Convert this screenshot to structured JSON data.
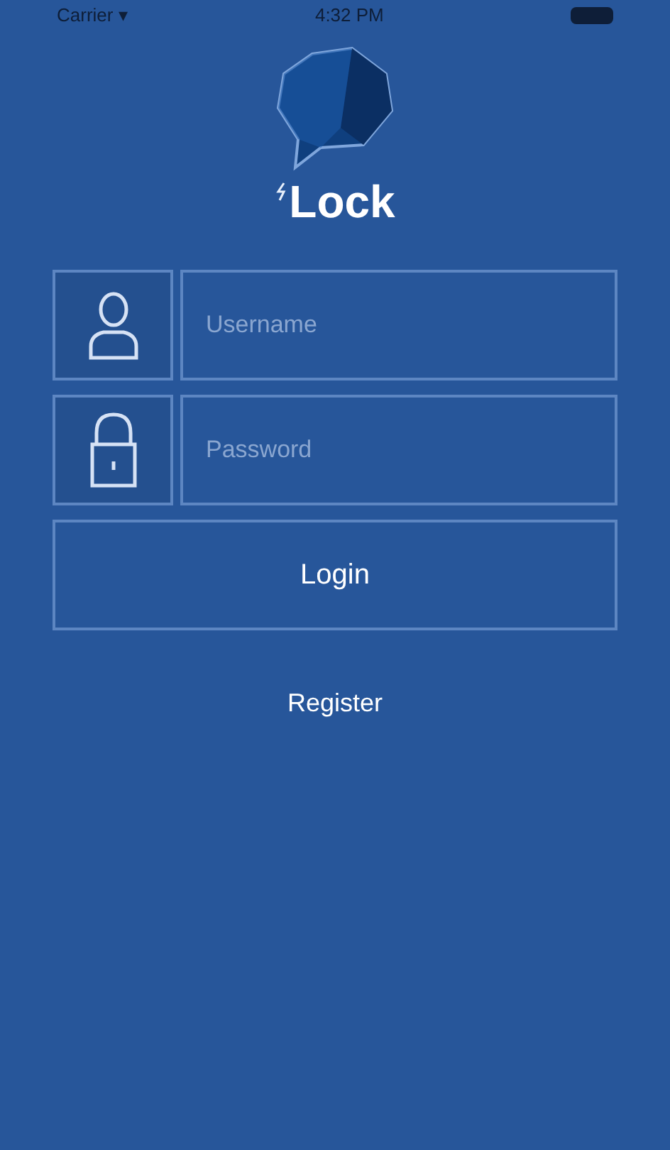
{
  "status_bar": {
    "carrier": "Carrier",
    "signal_glyph": "▾",
    "time": "4:32 PM"
  },
  "logo": {
    "text": "Lock"
  },
  "fields": [
    {
      "kind": "user",
      "placeholder": "Username"
    },
    {
      "kind": "lock",
      "placeholder": "Password"
    }
  ],
  "login_button": "Login",
  "register_link": "Register"
}
